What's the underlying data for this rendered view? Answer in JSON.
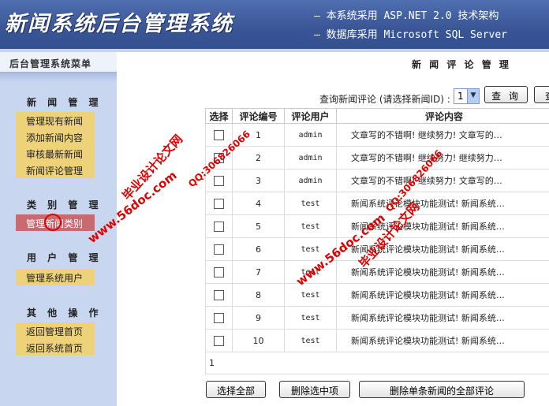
{
  "header": {
    "title": "新闻系统后台管理系统",
    "subtitle_1": "— 本系统采用 ASP.NET 2.0 技术架构",
    "subtitle_2": "— 数据库采用 Microsoft SQL Server"
  },
  "sidebar": {
    "menu_title": "后台管理系统菜单",
    "sections": [
      {
        "title": "新 闻 管 理",
        "items": [
          "管理现有新闻",
          "添加新闻内容",
          "审核最新新闻",
          "新闻评论管理"
        ]
      },
      {
        "title": "类 别 管 理",
        "items": [
          "管理新闻类别"
        ]
      },
      {
        "title": "用 户 管 理",
        "items": [
          "管理系统用户"
        ]
      },
      {
        "title": "其 他 操 作",
        "items": [
          "返回管理首页",
          "返回系统首页"
        ]
      }
    ],
    "active_item": "管理新闻类别"
  },
  "main": {
    "heading": "新 闻 评 论 管 理",
    "query_label": "查询新闻评论 (请选择新闻ID) :",
    "query_selected": "1",
    "query_button": "查 询",
    "query_button_2": "查"
  },
  "table": {
    "columns": [
      "选择",
      "评论编号",
      "评论用户",
      "评论内容"
    ],
    "rows": [
      {
        "id": "1",
        "user": "admin",
        "content": "文章写的不错啊! 继续努力! 文章写的…"
      },
      {
        "id": "2",
        "user": "admin",
        "content": "文章写的不错啊! 继续努力! 继续努力…"
      },
      {
        "id": "3",
        "user": "admin",
        "content": "文章写的不错啊! 继续努力! 文章写的…"
      },
      {
        "id": "4",
        "user": "test",
        "content": "新闻系统评论模块功能测试! 新闻系统…"
      },
      {
        "id": "5",
        "user": "test",
        "content": "新闻系统评论模块功能测试! 新闻系统…"
      },
      {
        "id": "6",
        "user": "test",
        "content": "新闻系统评论模块功能测试! 新闻系统…"
      },
      {
        "id": "7",
        "user": "test",
        "content": "新闻系统评论模块功能测试! 新闻系统…"
      },
      {
        "id": "8",
        "user": "test",
        "content": "新闻系统评论模块功能测试! 新闻系统…"
      },
      {
        "id": "9",
        "user": "test",
        "content": "新闻系统评论模块功能测试! 新闻系统…"
      },
      {
        "id": "10",
        "user": "test",
        "content": "新闻系统评论模块功能测试! 新闻系统…"
      }
    ],
    "pager": "1"
  },
  "actions": {
    "select_all": "选择全部",
    "delete_selected": "删除选中项",
    "delete_all_for_news": "删除单条新闻的全部评论"
  },
  "watermarks": {
    "site": "www.56doc.com",
    "qq": "QQ:306826066",
    "brand": "毕业设计论文网"
  },
  "colors": {
    "header_bg": "#3a5596",
    "sidebar_bg": "#c8d6ef",
    "menu_item_bg": "#eed27a",
    "menu_item_active_bg": "#c96970",
    "watermark": "#e00000"
  }
}
